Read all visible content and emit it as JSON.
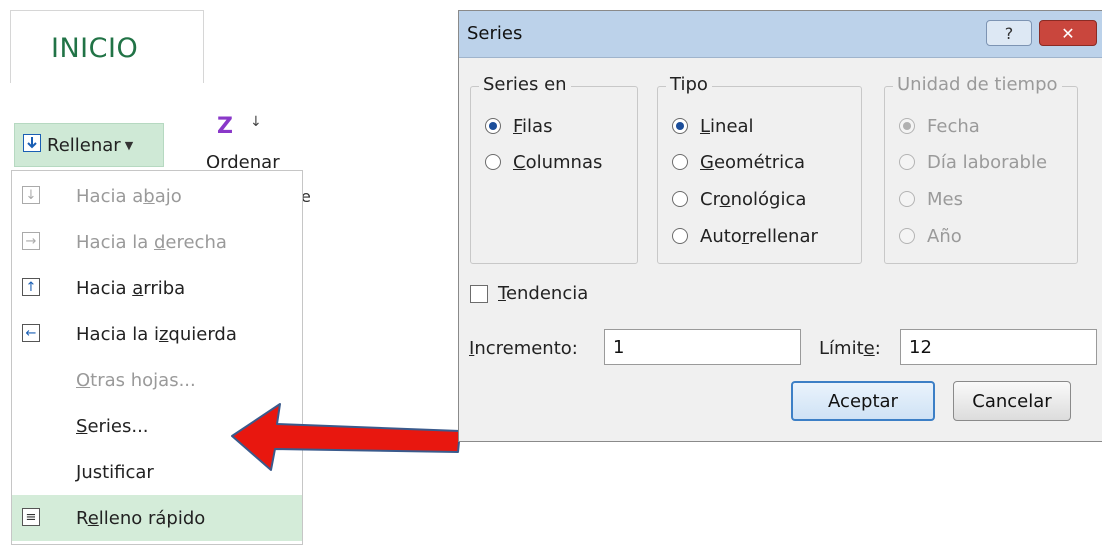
{
  "ribbon": {
    "tab_label": "INICIO",
    "fill_button_label": "Rellenar",
    "sort_icon_letter": "Z",
    "sort_icon_letter2": "↓",
    "sort_label": "Ordenar",
    "side_letter": "e"
  },
  "menu": {
    "items": [
      {
        "pre": "Hacia a",
        "key": "b",
        "post": "ajo",
        "icon": "↓",
        "icon_name": "fill-down-icon",
        "enabled": false
      },
      {
        "pre": "Hacia la ",
        "key": "d",
        "post": "erecha",
        "icon": "→",
        "icon_name": "fill-right-icon",
        "enabled": false
      },
      {
        "pre": "Hacia ",
        "key": "a",
        "post": "rriba",
        "icon": "↑",
        "icon_name": "fill-up-icon",
        "enabled": true
      },
      {
        "pre": "Hacia la i",
        "key": "z",
        "post": "quierda",
        "icon": "←",
        "icon_name": "fill-left-icon",
        "enabled": true
      },
      {
        "pre": "",
        "key": "O",
        "post": "tras hojas...",
        "enabled": false
      },
      {
        "pre": "",
        "key": "S",
        "post": "eries...",
        "enabled": true
      },
      {
        "pre": "",
        "key": "J",
        "post": "ustificar",
        "enabled": true
      },
      {
        "pre": "R",
        "key": "e",
        "post": "lleno rápido",
        "icon": "≡",
        "icon_name": "flash-fill-icon",
        "enabled": true,
        "highlighted": true
      }
    ]
  },
  "dialog": {
    "title": "Series",
    "help_label": "?",
    "close_label": "✕",
    "series_in": {
      "title": "Series en",
      "options": [
        {
          "pre": "",
          "key": "F",
          "post": "ilas",
          "checked": true
        },
        {
          "pre": "",
          "key": "C",
          "post": "olumnas",
          "checked": false
        }
      ]
    },
    "type": {
      "title": "Tipo",
      "options": [
        {
          "pre": "",
          "key": "L",
          "post": "ineal",
          "checked": true
        },
        {
          "pre": "",
          "key": "G",
          "post": "eométrica",
          "checked": false
        },
        {
          "pre": "Cr",
          "key": "o",
          "post": "nológica",
          "checked": false
        },
        {
          "pre": "Auto",
          "key": "r",
          "post": "rellenar",
          "checked": false
        }
      ]
    },
    "time_unit": {
      "title": "Unidad de tiempo",
      "options": [
        {
          "label": "Fecha",
          "checked": true
        },
        {
          "label": "Día laborable",
          "checked": false
        },
        {
          "label": "Mes",
          "checked": false
        },
        {
          "label": "Año",
          "checked": false
        }
      ]
    },
    "trend": {
      "pre": "",
      "key": "T",
      "post": "endencia",
      "checked": false
    },
    "increment": {
      "pre": "",
      "key": "I",
      "post": "ncremento:",
      "value": "1"
    },
    "limit": {
      "pre": "Límit",
      "key": "e",
      "post": ":",
      "value": "12"
    },
    "ok_label": "Aceptar",
    "cancel_label": "Cancelar"
  },
  "colors": {
    "excel_green": "#217346",
    "highlight_green": "#d4ecd9",
    "arrow_red": "#e8170f",
    "arrow_stroke": "#3a5a8c",
    "title_bar": "#bcd2ea",
    "close_red": "#c9463d"
  }
}
